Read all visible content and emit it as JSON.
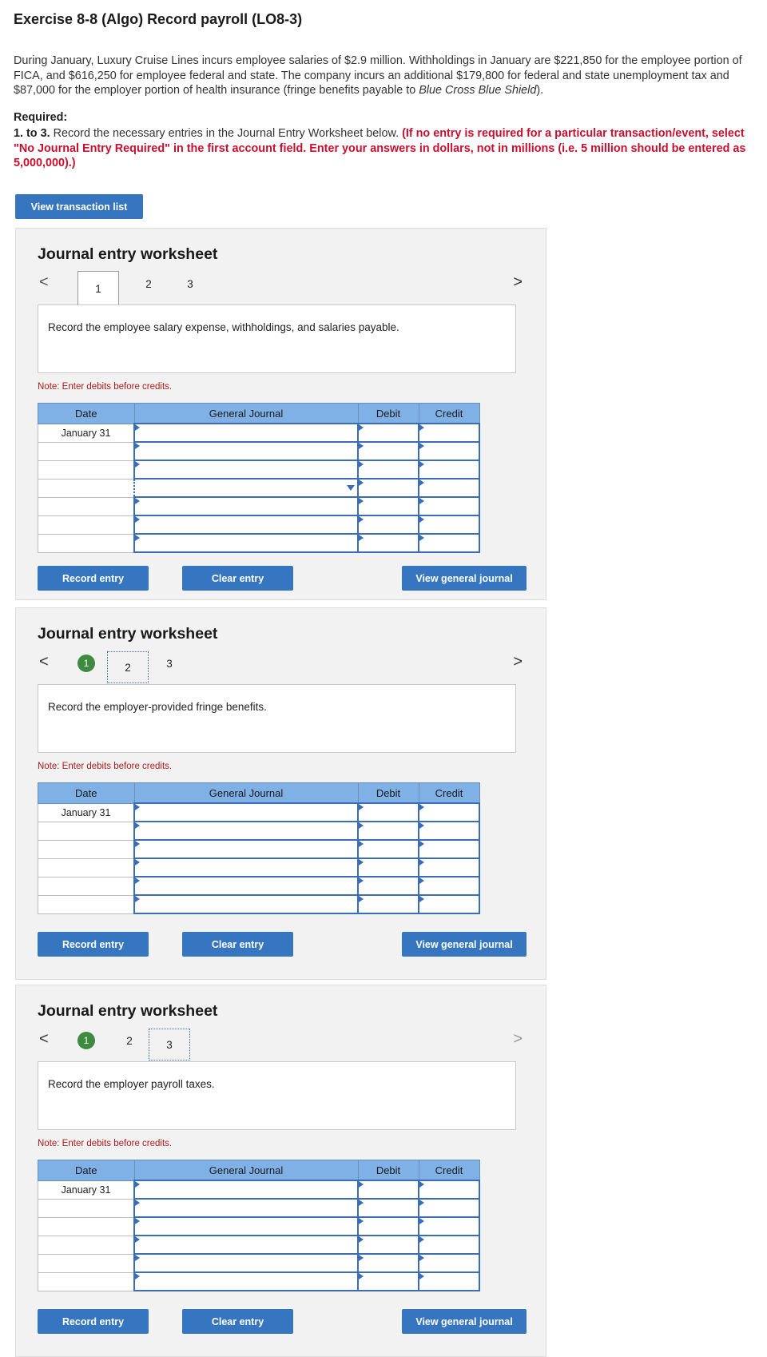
{
  "title": "Exercise 8-8 (Algo) Record payroll (LO8-3)",
  "intro": {
    "text_before": "During January, Luxury Cruise Lines incurs employee salaries of $2.9 million. Withholdings in January are $221,850 for the employee portion of FICA, and $616,250 for employee federal and state. The company incurs an additional $179,800 for federal and state unemployment tax and $87,000 for the employer portion of health insurance (fringe benefits payable to ",
    "italic": "Blue Cross Blue Shield",
    "text_after": ")."
  },
  "required": {
    "label": "Required:",
    "step": "1. to 3.",
    "text": " Record the necessary entries in the Journal Entry Worksheet below. ",
    "red": "(If no entry is required for a particular transaction/event, select \"No Journal Entry Required\" in the first account field. Enter your answers in dollars, not in millions (i.e. 5 million should be entered as 5,000,000).)"
  },
  "view_transaction_list": "View transaction list",
  "worksheets": [
    {
      "heading": "Journal entry worksheet",
      "tabs": [
        "1",
        "2",
        "3"
      ],
      "description": "Record the employee salary expense, withholdings, and salaries payable.",
      "note": "Note: Enter debits before credits.",
      "columns": [
        "Date",
        "General Journal",
        "Debit",
        "Credit"
      ],
      "date": "January 31",
      "buttons": {
        "record": "Record entry",
        "clear": "Clear entry",
        "view": "View general journal"
      }
    },
    {
      "heading": "Journal entry worksheet",
      "tabs": [
        "1",
        "2",
        "3"
      ],
      "description": "Record the employer-provided fringe benefits.",
      "note": "Note: Enter debits before credits.",
      "columns": [
        "Date",
        "General Journal",
        "Debit",
        "Credit"
      ],
      "date": "January 31",
      "buttons": {
        "record": "Record entry",
        "clear": "Clear entry",
        "view": "View general journal"
      }
    },
    {
      "heading": "Journal entry worksheet",
      "tabs": [
        "1",
        "2",
        "3"
      ],
      "description": "Record the employer payroll taxes.",
      "note": "Note: Enter debits before credits.",
      "columns": [
        "Date",
        "General Journal",
        "Debit",
        "Credit"
      ],
      "date": "January 31",
      "buttons": {
        "record": "Record entry",
        "clear": "Clear entry",
        "view": "View general journal"
      }
    }
  ],
  "nav": {
    "prev": "<",
    "next": ">"
  },
  "colors": {
    "button": "#3676c0",
    "header": "#7fb1e6",
    "completed_tab": "#3e8a41",
    "instruction_red": "#c8102e"
  },
  "icons": [
    "chevron-left-icon",
    "chevron-right-icon",
    "dropdown-arrow-icon",
    "check-circle-icon"
  ]
}
